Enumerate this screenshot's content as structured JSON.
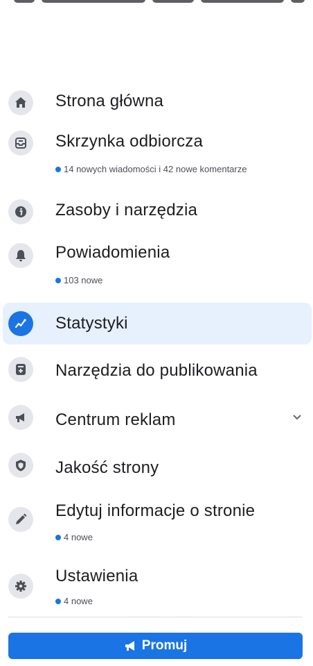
{
  "menu": {
    "items": [
      {
        "id": "home",
        "label": "Strona główna",
        "icon": "home-icon"
      },
      {
        "id": "inbox",
        "label": "Skrzynka odbiorcza",
        "icon": "inbox-icon",
        "sub": "14 nowych wiadomości i 42 nowe komentarze"
      },
      {
        "id": "resources",
        "label": "Zasoby i narzędzia",
        "icon": "info-icon"
      },
      {
        "id": "notifications",
        "label": "Powiadomienia",
        "icon": "bell-icon",
        "sub": "103 nowe"
      },
      {
        "id": "insights",
        "label": "Statystyki",
        "icon": "insights-icon",
        "active": true
      },
      {
        "id": "publishing",
        "label": "Narzędzia do publikowania",
        "icon": "publishing-tools-icon"
      },
      {
        "id": "ad-center",
        "label": "Centrum reklam",
        "icon": "megaphone-icon",
        "expandable": true
      },
      {
        "id": "page-quality",
        "label": "Jakość strony",
        "icon": "shield-icon"
      },
      {
        "id": "edit-page-info",
        "label": "Edytuj informacje o stronie",
        "icon": "pencil-icon",
        "sub": "4 nowe"
      },
      {
        "id": "settings",
        "label": "Ustawienia",
        "icon": "gear-icon",
        "sub": "4 nowe"
      }
    ]
  },
  "promote_button": {
    "label": "Promuj",
    "icon": "megaphone-icon"
  },
  "colors": {
    "accent": "#1b74e4",
    "active_bg": "#e7f0fd",
    "icon_bg": "#e4e6eb",
    "icon_fg": "#4b4f56",
    "divider": "#dadde1"
  }
}
